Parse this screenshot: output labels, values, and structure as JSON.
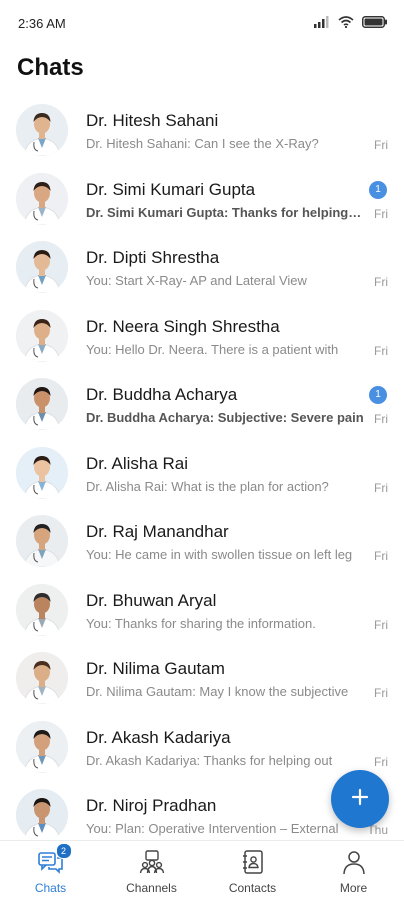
{
  "status_bar": {
    "time": "2:36 AM",
    "icons": [
      "cellular-signal-icon",
      "wifi-icon",
      "battery-icon"
    ]
  },
  "header": {
    "title": "Chats"
  },
  "colors": {
    "accent": "#1f77d0",
    "badge": "#4a90e2",
    "active_nav": "#2f7fd6"
  },
  "chats": [
    {
      "name": "Dr. Hitesh Sahani",
      "preview": "Dr. Hitesh Sahani: Can I see the X-Ray?",
      "time": "Fri",
      "unread": ""
    },
    {
      "name": "Dr. Simi Kumari Gupta",
      "preview": "Dr. Simi Kumari Gupta: Thanks for helping me",
      "time": "Fri",
      "unread": "1"
    },
    {
      "name": "Dr. Dipti Shrestha",
      "preview": "You: Start X-Ray- AP and Lateral View",
      "time": "Fri",
      "unread": ""
    },
    {
      "name": "Dr. Neera Singh Shrestha",
      "preview": "You: Hello Dr. Neera. There is a patient with",
      "time": "Fri",
      "unread": ""
    },
    {
      "name": "Dr. Buddha Acharya",
      "preview": "Dr. Buddha Acharya: Subjective: Severe pain",
      "time": "Fri",
      "unread": "1"
    },
    {
      "name": "Dr. Alisha Rai",
      "preview": "Dr. Alisha Rai: What is the plan for action?",
      "time": "Fri",
      "unread": ""
    },
    {
      "name": "Dr. Raj Manandhar",
      "preview": "You: He came in with swollen tissue on left leg",
      "time": "Fri",
      "unread": ""
    },
    {
      "name": "Dr. Bhuwan Aryal",
      "preview": "You: Thanks for sharing the information.",
      "time": "Fri",
      "unread": ""
    },
    {
      "name": "Dr. Nilima Gautam",
      "preview": "Dr. Nilima Gautam: May I know the subjective",
      "time": "Fri",
      "unread": ""
    },
    {
      "name": "Dr. Akash Kadariya",
      "preview": "Dr. Akash Kadariya: Thanks for helping out",
      "time": "Fri",
      "unread": ""
    },
    {
      "name": "Dr. Niroj Pradhan",
      "preview": "You: Plan: Operative Intervention – External",
      "time": "Thu",
      "unread": ""
    }
  ],
  "fab": {
    "icon": "plus-icon"
  },
  "bottom_nav": [
    {
      "label": "Chats",
      "icon": "chat-bubbles-icon",
      "badge": "2",
      "active": true
    },
    {
      "label": "Channels",
      "icon": "channels-group-icon",
      "badge": "",
      "active": false
    },
    {
      "label": "Contacts",
      "icon": "contacts-book-icon",
      "badge": "",
      "active": false
    },
    {
      "label": "More",
      "icon": "person-icon",
      "badge": "",
      "active": false
    }
  ]
}
